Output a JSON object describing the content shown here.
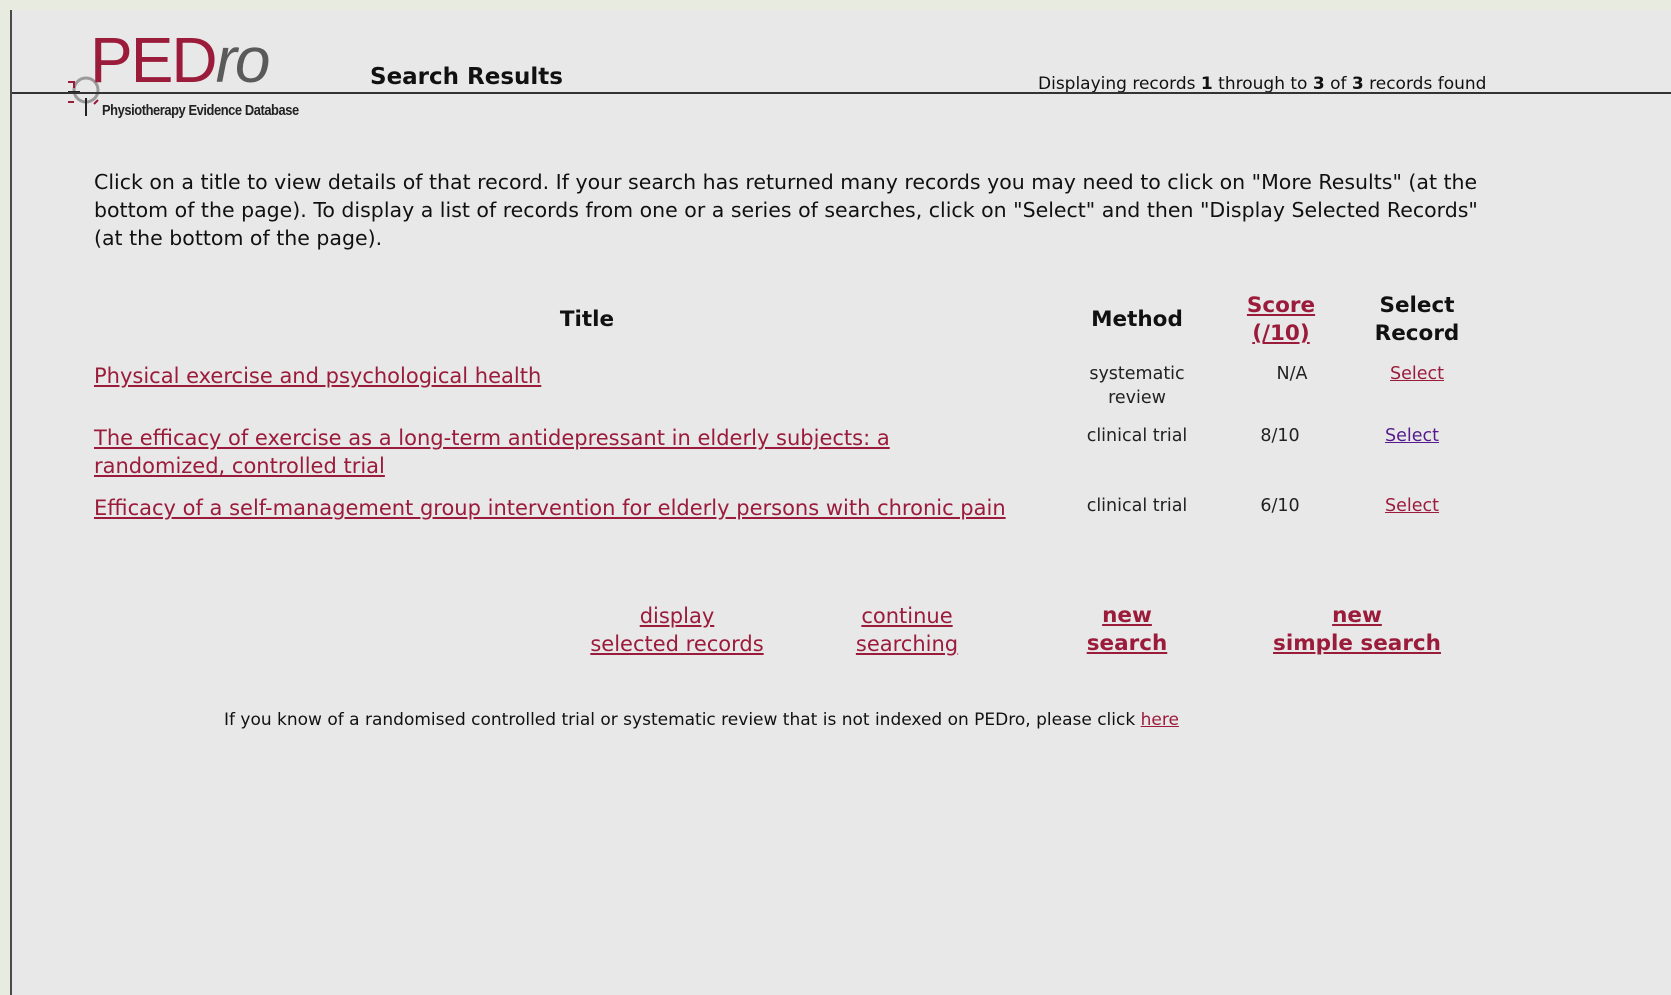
{
  "logo": {
    "wordmark_main": "PED",
    "wordmark_italic": "ro",
    "subtitle": "Physiotherapy Evidence Database"
  },
  "header": {
    "title": "Search Results",
    "records_prefix": "Displaying records ",
    "records_from": "1",
    "records_mid1": " through to ",
    "records_to": "3",
    "records_mid2": " of ",
    "records_total": "3",
    "records_suffix": " records found"
  },
  "intro": "Click on a title to view details of that record. If your search has returned many records you may need to click on \"More Results\" (at the bottom of the page). To display a list of records from one or a series of searches, click on \"Select\" and then \"Display Selected Records\" (at the bottom of the page).",
  "table": {
    "headers": {
      "title": "Title",
      "method": "Method",
      "score_line1": "Score",
      "score_line2": "(/10)",
      "select_line1": "Select",
      "select_line2": "Record"
    },
    "rows": [
      {
        "title": "Physical exercise and psychological health",
        "method_line1": "systematic",
        "method_line2": "review",
        "score": "N/A",
        "select": "Select"
      },
      {
        "title": "The efficacy of exercise as a long-term antidepressant in elderly subjects: a randomized, controlled trial",
        "method_line1": "clinical trial",
        "method_line2": "",
        "score": "8/10",
        "select": "Select"
      },
      {
        "title": "Efficacy of a self-management group intervention for elderly persons with chronic pain",
        "method_line1": "clinical trial",
        "method_line2": "",
        "score": "6/10",
        "select": "Select"
      }
    ]
  },
  "actions": {
    "display_line1": "display",
    "display_line2": "selected records",
    "continue_line1": "continue",
    "continue_line2": "searching",
    "new_line1": "new",
    "new_line2": "search",
    "simple_line1": "new",
    "simple_line2": "simple search"
  },
  "footer": {
    "text": "If you know of a randomised controlled trial or systematic review that is not indexed on PEDro, please click ",
    "link": "here"
  },
  "colors": {
    "brand": "#9b1b3b",
    "visited_link": "#551a8b",
    "background": "#e8e8e8"
  }
}
